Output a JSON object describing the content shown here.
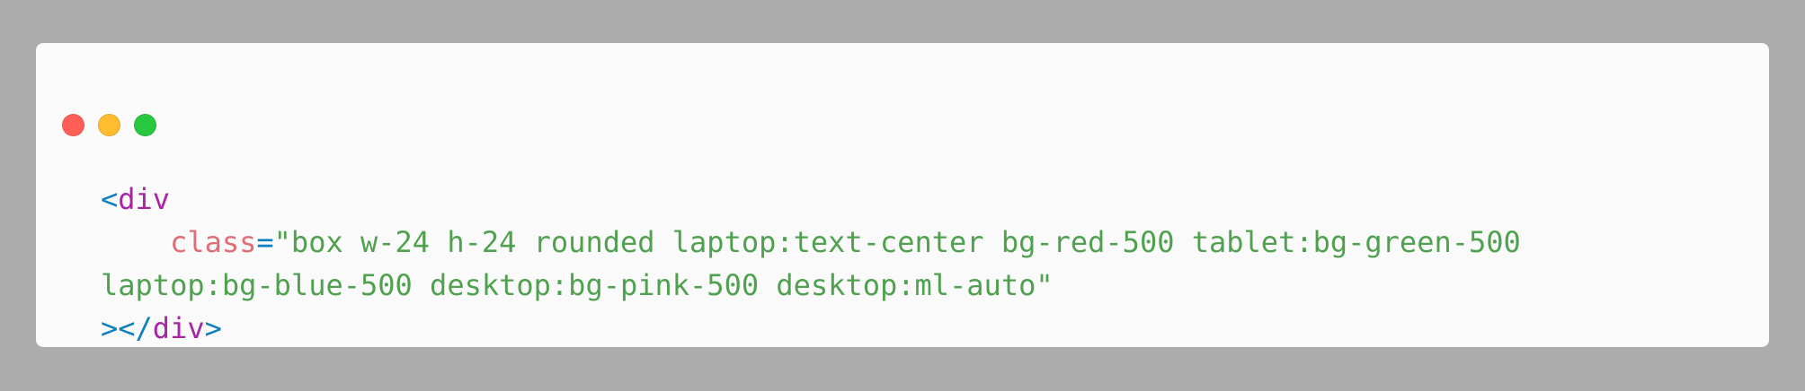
{
  "window": {
    "controls": [
      {
        "name": "close",
        "color": "#ff5f57",
        "icon": "close-dot-icon"
      },
      {
        "name": "minimize",
        "color": "#febc2e",
        "icon": "minimize-dot-icon"
      },
      {
        "name": "zoom",
        "color": "#28c840",
        "icon": "zoom-dot-icon"
      }
    ]
  },
  "code": {
    "line1": {
      "open_bracket": "<",
      "tag": "div"
    },
    "line2": {
      "indent": "    ",
      "attr": "class",
      "equals": "=",
      "value_part1": "\"box w-24 h-24 rounded laptop:text-center bg-red-500 tablet:bg-green-500"
    },
    "line3": {
      "value_part2": "laptop:bg-blue-500 desktop:bg-pink-500 desktop:ml-auto\""
    },
    "line4": {
      "close_open": "></",
      "tag": "div",
      "close_bracket": ">"
    }
  },
  "colors": {
    "background": "#ababab",
    "panel": "#fafafa",
    "punctuation": "#0b7fbf",
    "tag": "#a626a4",
    "attribute": "#e06c75",
    "string": "#50a14f"
  }
}
